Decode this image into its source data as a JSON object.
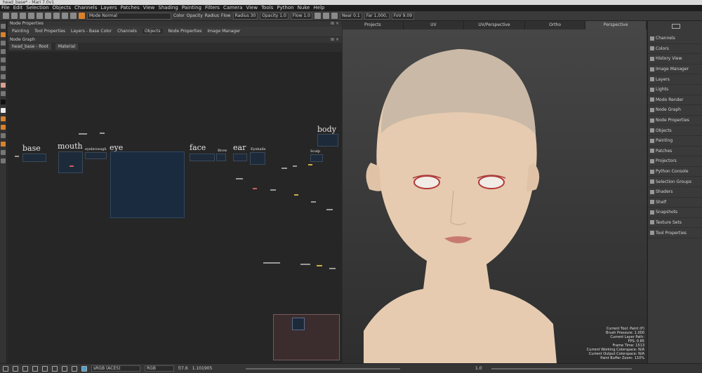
{
  "window": {
    "title": "head_base* - Mari 7.0v1"
  },
  "menu": [
    "File",
    "Edit",
    "Selection",
    "Objects",
    "Channels",
    "Layers",
    "Patches",
    "View",
    "Shading",
    "Painting",
    "Filters",
    "Camera",
    "View",
    "Tools",
    "Python",
    "Nuke",
    "Help"
  ],
  "toolbar": {
    "mode": "Mode Normal",
    "color_label": "Color",
    "opacity_label": "Opacity",
    "radius_check": "Radius",
    "flow_check": "Flow",
    "radius_value": "Radius 30",
    "opacity_value": "Opacity 1.0",
    "flow_value": "Flow 1.0",
    "near": "Near 0.1",
    "far": "Far 1,000,",
    "fov": "FoV 9.09"
  },
  "node_properties": {
    "title": "Node Properties",
    "tabs": [
      "Painting",
      "Tool Properties",
      "Layers - Base Color",
      "Channels",
      "Objects",
      "Node Properties",
      "Image Manager"
    ],
    "active_tab": "Objects"
  },
  "node_graph": {
    "title": "Node Graph",
    "crumbs": [
      "head_base - Root",
      "Material"
    ],
    "groups": [
      "base",
      "mouth",
      "eye",
      "face",
      "ear",
      "body"
    ],
    "small_labels": [
      "eyebrowsgli",
      "Brow",
      "Eyeballs",
      "Scalp"
    ]
  },
  "viewport": {
    "tabs": [
      "Projects",
      "UV",
      "UV/Perspective",
      "Ortho",
      "Perspective"
    ],
    "active_tab": "Perspective",
    "hud": [
      "Current Tool: Paint (P)",
      "Brush Pressure: 1.000",
      "Current Layer Path:",
      "FPS: 0.85",
      "Frame Time: 1513",
      "Current Working Colorspace: N/A",
      "Current Output Colorspace: N/A",
      "Paint Buffer Zoom: 110%"
    ]
  },
  "right_dock": [
    "Channels",
    "Colors",
    "History View",
    "Image Manager",
    "Layers",
    "Lights",
    "Modo Render",
    "Node Graph",
    "Node Properties",
    "Objects",
    "Painting",
    "Patches",
    "Projectors",
    "Python Console",
    "Selection Groups",
    "Shaders",
    "Shelf",
    "Snapshots",
    "Texture Sets",
    "Tool Properties"
  ],
  "statusbar": {
    "colorspace": "sRGB (ACES)",
    "channel": "RGB",
    "fstop": "f/7.6",
    "zoom": "1.101905",
    "value": "1.0"
  },
  "colors": {
    "accent": "#d9822b",
    "node_blue": "#1a2b40",
    "viewport_bg": "#3c3c3c"
  }
}
